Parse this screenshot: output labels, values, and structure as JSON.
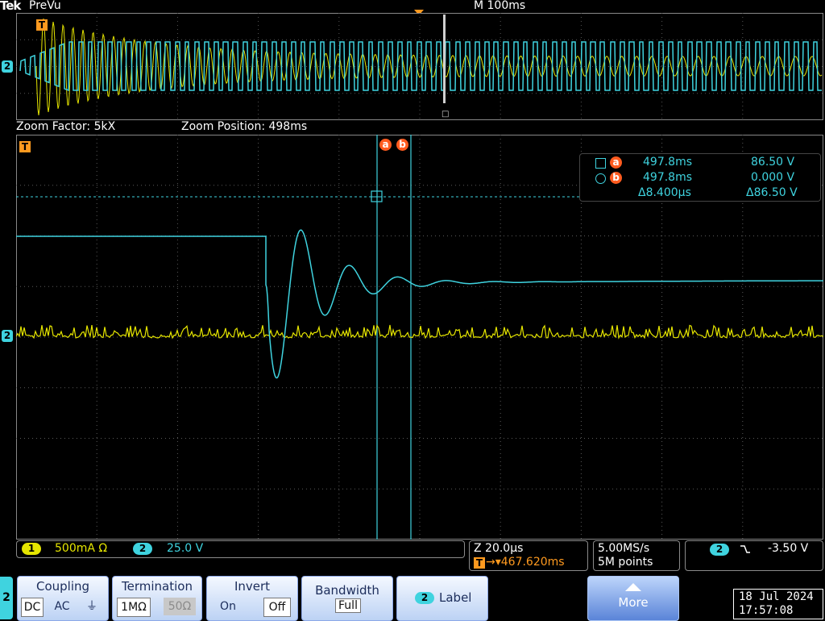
{
  "header": {
    "brand": "Tek",
    "mode": "PreVu",
    "main_timebase": "M 100ms"
  },
  "overview": {
    "trigger_label": "T",
    "channel_marker": "2",
    "cursor_marker": "□"
  },
  "zoom": {
    "factor": "Zoom Factor: 5kX",
    "position": "Zoom Position: 498ms"
  },
  "main": {
    "trigger_label": "T",
    "channel_marker": "2",
    "cursor_a_label": "a",
    "cursor_b_label": "b"
  },
  "cursors": {
    "a_time": "497.8ms",
    "a_value": "86.50 V",
    "b_time": "497.8ms",
    "b_value": "0.000 V",
    "delta_time": "Δ8.400µs",
    "delta_value": "Δ86.50 V",
    "a_label": "a",
    "b_label": "b"
  },
  "status": {
    "ch1_label": "1",
    "ch1_scale": "500mA Ω",
    "ch2_label": "2",
    "ch2_scale": "25.0 V"
  },
  "horizontal": {
    "zoom_scale": "Z 20.0µs",
    "trigger_pos": "→▾467.620ms",
    "trigger_icon": "T",
    "sample_rate": "5.00MS/s",
    "record_length": "5M points"
  },
  "trigger": {
    "channel": "2",
    "slope": "⿻",
    "level": "-3.50 V"
  },
  "menu": {
    "channel_tab": "2",
    "coupling": {
      "title": "Coupling",
      "opt_dc": "DC",
      "opt_ac": "AC",
      "opt_gnd": "⏚"
    },
    "termination": {
      "title": "Termination",
      "opt_1m": "1MΩ",
      "opt_50": "50Ω"
    },
    "invert": {
      "title": "Invert",
      "opt_on": "On",
      "opt_off": "Off"
    },
    "bandwidth": {
      "title": "Bandwidth",
      "value": "Full"
    },
    "label": {
      "channel": "2",
      "title": "Label"
    },
    "more": {
      "title": "More"
    }
  },
  "datetime": {
    "date": "18 Jul  2024",
    "time": "17:57:08"
  },
  "colors": {
    "ch1": "#e6e600",
    "ch2": "#3fd3df",
    "cursor": "#ff5b1f",
    "trigger": "#ff9a1f"
  }
}
